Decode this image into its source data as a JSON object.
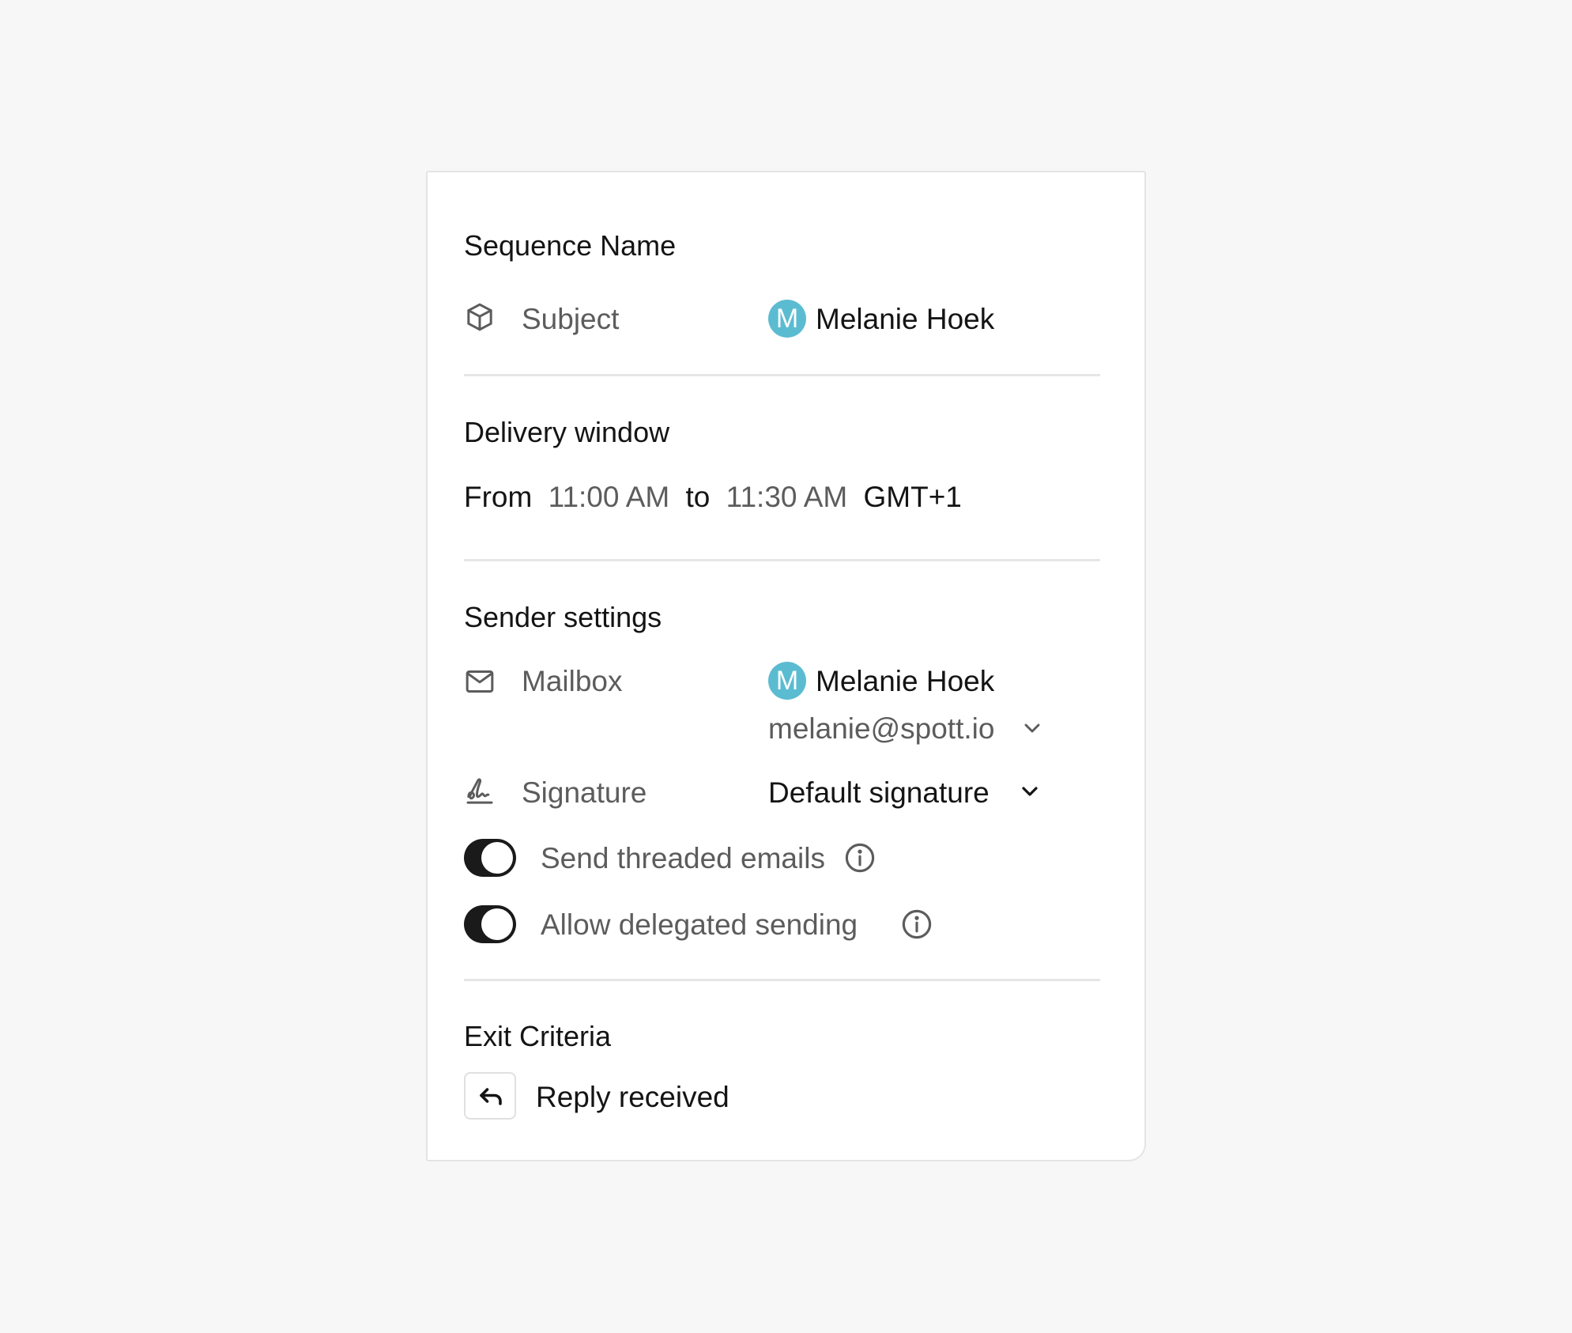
{
  "sequence": {
    "title": "Sequence Name",
    "subject_label": "Subject",
    "owner_initial": "M",
    "owner_name": "Melanie Hoek"
  },
  "delivery": {
    "title": "Delivery window",
    "from_label": "From",
    "start_time": "11:00 AM",
    "to_label": "to",
    "end_time": "11:30 AM",
    "timezone": "GMT+1"
  },
  "sender": {
    "title": "Sender settings",
    "mailbox_label": "Mailbox",
    "mailbox_initial": "M",
    "mailbox_name": "Melanie Hoek",
    "mailbox_email": "melanie@spott.io",
    "signature_label": "Signature",
    "signature_value": "Default signature",
    "threaded_label": "Send threaded emails",
    "threaded_on": true,
    "delegated_label": "Allow delegated sending",
    "delegated_on": true
  },
  "exit": {
    "title": "Exit Criteria",
    "criteria_label": "Reply received"
  },
  "colors": {
    "avatar": "#5bbcd1",
    "toggle_on": "#1a1a1a",
    "text_dark": "#141414",
    "text_muted": "#5c5c5c",
    "divider": "#e6e6e6",
    "background": "#f7f7f7"
  },
  "icons": {
    "subject": "cube-icon",
    "mailbox": "mail-icon",
    "signature": "signature-icon",
    "info": "info-icon",
    "chevron": "chevron-down-icon",
    "reply": "reply-arrow-icon"
  }
}
